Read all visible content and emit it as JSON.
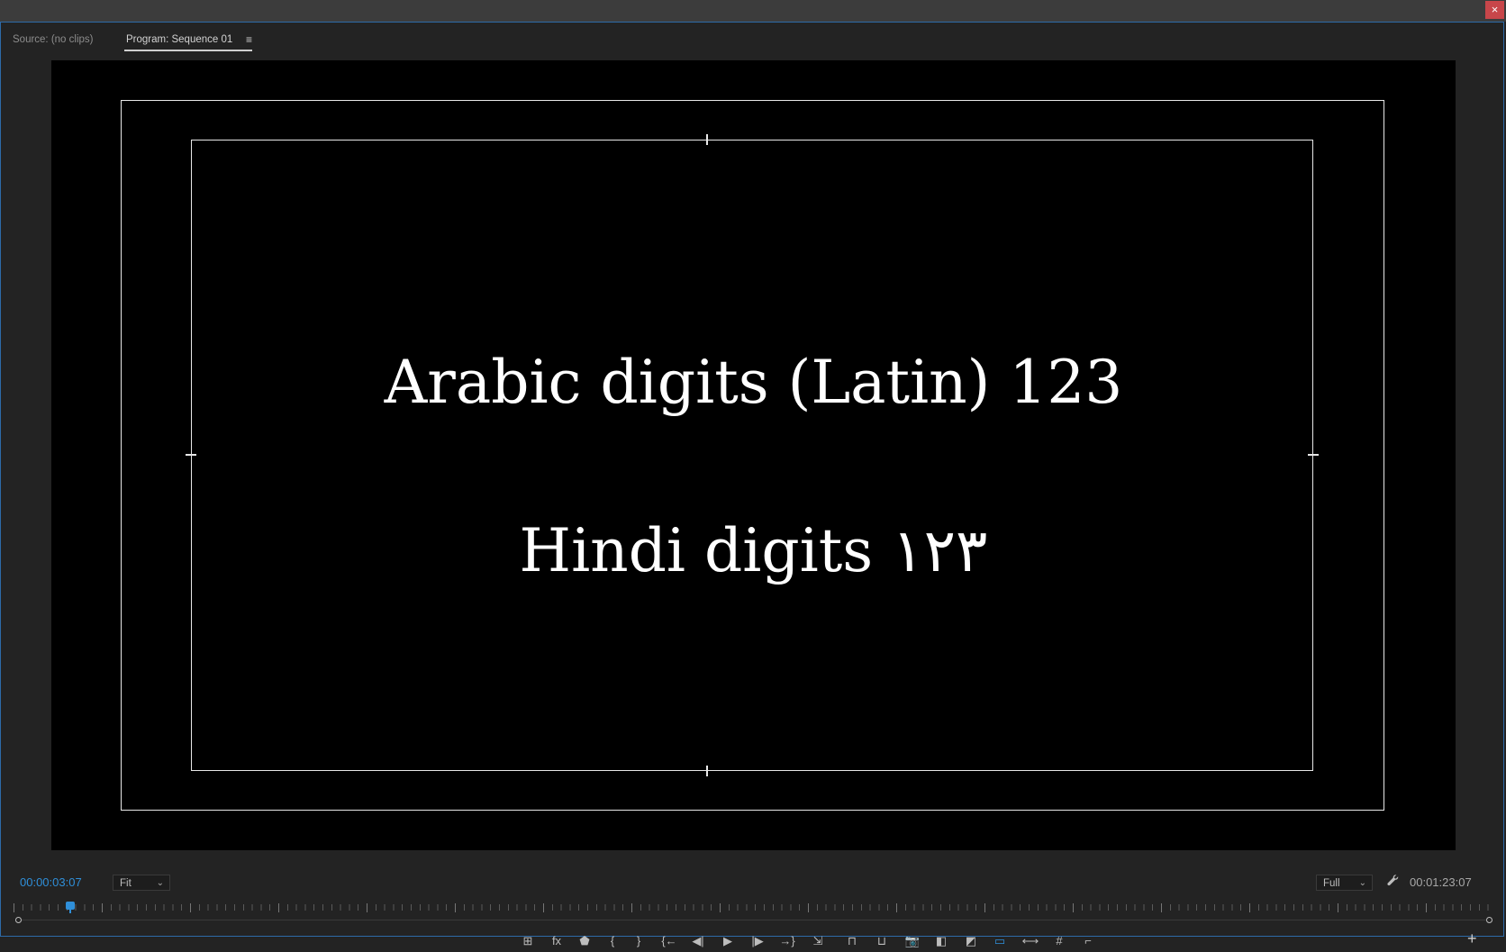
{
  "window": {
    "close_icon": "×"
  },
  "tabs": {
    "source_label": "Source: (no clips)",
    "program_label": "Program: Sequence 01",
    "menu_icon": "≡"
  },
  "viewer": {
    "line1": "Arabic digits (Latin) 123",
    "line2": "Hindi digits ١٢٣"
  },
  "footer": {
    "current_timecode": "00:00:03:07",
    "zoom_value": "Fit",
    "resolution_value": "Full",
    "duration_timecode": "00:01:23:07",
    "wrench_icon": "🔧",
    "add_icon": "+"
  },
  "controls": [
    {
      "name": "toggle-proxies-icon",
      "glyph": "⊞"
    },
    {
      "name": "fx-icon",
      "glyph": "fx"
    },
    {
      "name": "add-marker-icon",
      "glyph": "⬟"
    },
    {
      "name": "mark-in-icon",
      "glyph": "{"
    },
    {
      "name": "mark-out-icon",
      "glyph": "}"
    },
    {
      "name": "go-to-in-icon",
      "glyph": "{←"
    },
    {
      "name": "step-back-icon",
      "glyph": "◀|"
    },
    {
      "name": "play-icon",
      "glyph": "▶"
    },
    {
      "name": "step-forward-icon",
      "glyph": "|▶"
    },
    {
      "name": "go-to-out-icon",
      "glyph": "→}"
    },
    {
      "name": "export-frame-out-icon",
      "glyph": "⇲"
    },
    {
      "name": "lift-icon",
      "glyph": "⊓"
    },
    {
      "name": "extract-icon",
      "glyph": "⊔"
    },
    {
      "name": "camera-icon",
      "glyph": "📷"
    },
    {
      "name": "comparison-view-icon",
      "glyph": "◧"
    },
    {
      "name": "swap-icon",
      "glyph": "◩"
    },
    {
      "name": "safe-margins-icon",
      "glyph": "▭"
    },
    {
      "name": "vr-video-icon",
      "glyph": "⟷"
    },
    {
      "name": "grid-icon",
      "glyph": "#"
    },
    {
      "name": "ruler-icon",
      "glyph": "⌐"
    }
  ],
  "colors": {
    "accent": "#2f8fd9",
    "close": "#c8464a"
  }
}
